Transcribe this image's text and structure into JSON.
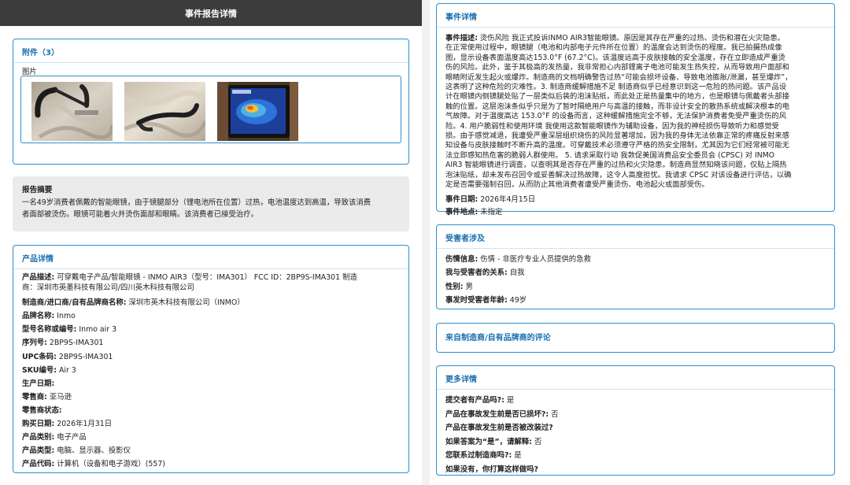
{
  "header": {
    "title": "事件报告详情"
  },
  "attachments": {
    "title": "附件（3）",
    "label": "图片",
    "images": [
      "photo-smart-glasses-on-fabric",
      "photo-smart-glasses-on-fabric-2",
      "photo-thermal-image-reading"
    ]
  },
  "summary": {
    "title": "报告摘要",
    "text_l1": "一名49岁消费者佩戴的智能眼镜，由于镜腿部分（锂电池所在位置）过热，电池温度达到高温，导致该消费",
    "text_l2": "者面部被烫伤。眼镜可能着火并烫伤面部和眼睛。该消费者已接受治疗。"
  },
  "product": {
    "title": "产品详情",
    "desc_label": "产品描述:",
    "desc_l1": "可穿戴电子产品/智能眼镜 - INMO AIR3（型号：IMA301） FCC ID：2BP9S-IMA301 制造",
    "desc_l2": "商：深圳市英墨科技有限公司/四川英木科技有限公司",
    "rows": [
      {
        "label": "制造商/进口商/自有品牌商名称:",
        "value": "深圳市英木科技有限公司（INMO）"
      },
      {
        "label": "品牌名称:",
        "value": "Inmo"
      },
      {
        "label": "型号名称或编号:",
        "value": "Inmo air 3"
      },
      {
        "label": "序列号:",
        "value": "2BP9S-IMA301"
      },
      {
        "label": "UPC条码:",
        "value": "2BP9S-IMA301"
      },
      {
        "label": "SKU编号:",
        "value": "Air 3"
      },
      {
        "label": "生产日期:",
        "value": ""
      },
      {
        "label": "零售商:",
        "value": "亚马逊"
      },
      {
        "label": "零售商状态:",
        "value": ""
      },
      {
        "label": "购买日期:",
        "value": "2026年1月31日"
      },
      {
        "label": "产品类别:",
        "value": "电子产品"
      },
      {
        "label": "产品类型:",
        "value": "电脑、显示器、投影仪"
      },
      {
        "label": "产品代码:",
        "value": "计算机（设备和电子游戏）(557)"
      }
    ]
  },
  "event": {
    "title": "事件详情",
    "desc_label": "事件描述:",
    "desc_lines": [
      "烫伤风险 我正式投诉INMO AIR3智能眼镜。原因是其存在严重的过热、烫伤和潜在火灾隐患。",
      "在正常使用过程中，眼镜腿（电池和内部电子元件所在位置）的温度会达到烫伤的程度。我已拍摄热成像",
      "图，显示设备表面温度高达153.0°F (67.2°C)。该温度远高于皮肤接触的安全温度，存在立即造成严重烫",
      "伤的风险。此外，鉴于其极高的发热量，我非常担心内部锂离子电池可能发生热失控，从而导致用户面部和",
      "眼睛附近发生起火或爆炸。制造商的文档明确警告过热“可能会损坏设备、导致电池膨胀/泄漏，甚至爆炸”，",
      "这表明了这种危险的灾难性。3. 制造商缓解措施不足 制造商似乎已经意识到这一危险的热问题。该产品设",
      "计在眼镜内侧镜腿处贴了一层类似后装的泡沫贴纸，而此处正是热量集中的地方，也是眼镜与佩戴者头部接",
      "触的位置。这层泡沫条似乎只是为了暂时隔绝用户与高温的接触，而非设计安全的散热系统或解决根本的电",
      "气故障。对于温度高达 153.0°F 的设备而言，这种缓解措施完全不够，无法保护消费者免受严重烫伤的风",
      "险。4. 用户脆弱性和使用环境 我使用这款智能眼镜作为辅助设备，因为我的神经损伤导致听力和感觉受",
      "损。由于感觉减退，我遭受严重深层组织烧伤的风险显著增加，因为我的身体无法依靠正常的疼痛反射来感",
      "知设备与皮肤接触时不断升高的温度。可穿戴技术必须遵守严格的热安全限制，尤其因为它们经常被可能无",
      "法立即感知热危害的脆弱人群使用。 5. 请求采取行动 我敦促美国消费品安全委员会 (CPSC) 对 INMO",
      "AIR3 智能眼镜进行调查，以查明其是否存在严重的过热和火灾隐患。制造商显然知晓该问题，仅贴上隔热",
      "泡沫贴纸，却未发布召回令或妥善解决过热故障，这令人高度担忧。我请求 CPSC 对该设备进行评估，以确",
      "定是否需要强制召回，从而防止其他消费者遭受严重烫伤、电池起火或面部受伤。"
    ],
    "date_label": "事件日期:",
    "date_value": "2026年4月15日",
    "loc_label": "事件地点:",
    "loc_value": "未指定"
  },
  "victim": {
    "title": "受害者涉及",
    "rows": [
      {
        "label": "伤情信息:",
        "value": "伤情 - 非医疗专业人员提供的急救"
      },
      {
        "label": "我与受害者的关系:",
        "value": "自我"
      },
      {
        "label": "性别:",
        "value": "男"
      },
      {
        "label": "事发时受害者年龄:",
        "value": "49岁"
      }
    ]
  },
  "comments": {
    "title": "来自制造商/自有品牌商的评论"
  },
  "more": {
    "title": "更多详情",
    "rows": [
      {
        "label": "提交者有产品吗?:",
        "value": "是"
      },
      {
        "label": "产品在事故发生前是否已损坏?:",
        "value": "否"
      },
      {
        "label": "产品在事故发生前是否被改装过?",
        "value": ""
      },
      {
        "label": "如果答案为“是”，请解释:",
        "value": "否"
      },
      {
        "label": "您联系过制造商吗?:",
        "value": "是"
      },
      {
        "label": "如果没有，你打算这样做吗?",
        "value": ""
      }
    ]
  },
  "colors": {
    "accent": "#2f8fd0",
    "title": "#1a6fb0",
    "topbar": "#3c3c3c",
    "summary_bg": "#ebebeb"
  }
}
